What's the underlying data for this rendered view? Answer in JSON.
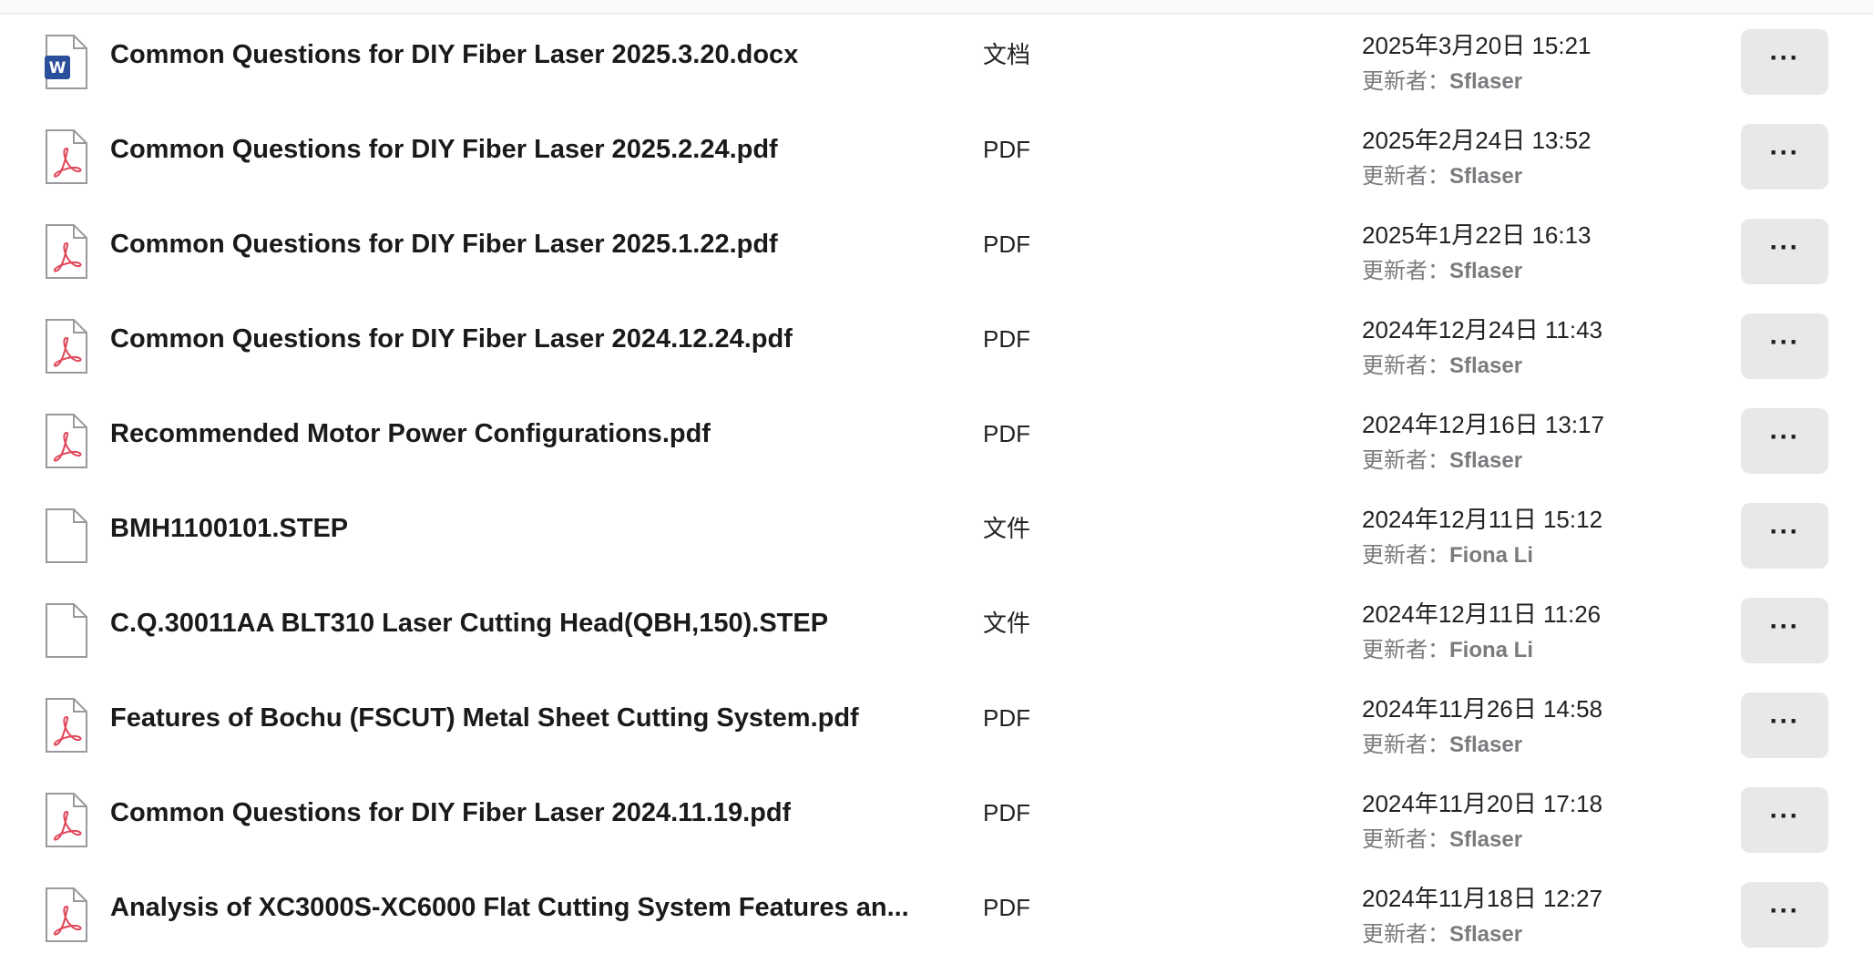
{
  "files": [
    {
      "name": "Common Questions for DIY Fiber Laser 2025.3.20.docx",
      "type": "文档",
      "icon": "word-doc-icon",
      "date": "2025年3月20日 15:21",
      "updater_label": "更新者：",
      "updater": "Sflaser"
    },
    {
      "name": "Common Questions for DIY Fiber Laser 2025.2.24.pdf",
      "type": "PDF",
      "icon": "pdf-icon",
      "date": "2025年2月24日 13:52",
      "updater_label": "更新者：",
      "updater": "Sflaser"
    },
    {
      "name": "Common Questions for DIY Fiber Laser 2025.1.22.pdf",
      "type": "PDF",
      "icon": "pdf-icon",
      "date": "2025年1月22日 16:13",
      "updater_label": "更新者：",
      "updater": "Sflaser"
    },
    {
      "name": "Common Questions for DIY Fiber Laser 2024.12.24.pdf",
      "type": "PDF",
      "icon": "pdf-icon",
      "date": "2024年12月24日 11:43",
      "updater_label": "更新者：",
      "updater": "Sflaser"
    },
    {
      "name": "Recommended Motor Power Configurations.pdf",
      "type": "PDF",
      "icon": "pdf-icon",
      "date": "2024年12月16日 13:17",
      "updater_label": "更新者：",
      "updater": "Sflaser"
    },
    {
      "name": "BMH1100101.STEP",
      "type": "文件",
      "icon": "generic-file-icon",
      "date": "2024年12月11日 15:12",
      "updater_label": "更新者：",
      "updater": "Fiona Li"
    },
    {
      "name": "C.Q.30011AA BLT310 Laser Cutting Head(QBH,150).STEP",
      "type": "文件",
      "icon": "generic-file-icon",
      "date": "2024年12月11日 11:26",
      "updater_label": "更新者：",
      "updater": "Fiona Li"
    },
    {
      "name": "Features of Bochu (FSCUT) Metal Sheet Cutting System.pdf",
      "type": "PDF",
      "icon": "pdf-icon",
      "date": "2024年11月26日 14:58",
      "updater_label": "更新者：",
      "updater": "Sflaser"
    },
    {
      "name": "Common Questions for DIY Fiber Laser 2024.11.19.pdf",
      "type": "PDF",
      "icon": "pdf-icon",
      "date": "2024年11月20日 17:18",
      "updater_label": "更新者：",
      "updater": "Sflaser"
    },
    {
      "name": "Analysis of XC3000S-XC6000 Flat Cutting System Features an...",
      "type": "PDF",
      "icon": "pdf-icon",
      "date": "2024年11月18日 12:27",
      "updater_label": "更新者：",
      "updater": "Sflaser"
    }
  ],
  "more_button_label": "···",
  "colors": {
    "pdf_accent": "#e0475a",
    "word_accent": "#2b4f9a",
    "button_bg": "#e8e8eb",
    "secondary_text": "#7b7b7f"
  }
}
